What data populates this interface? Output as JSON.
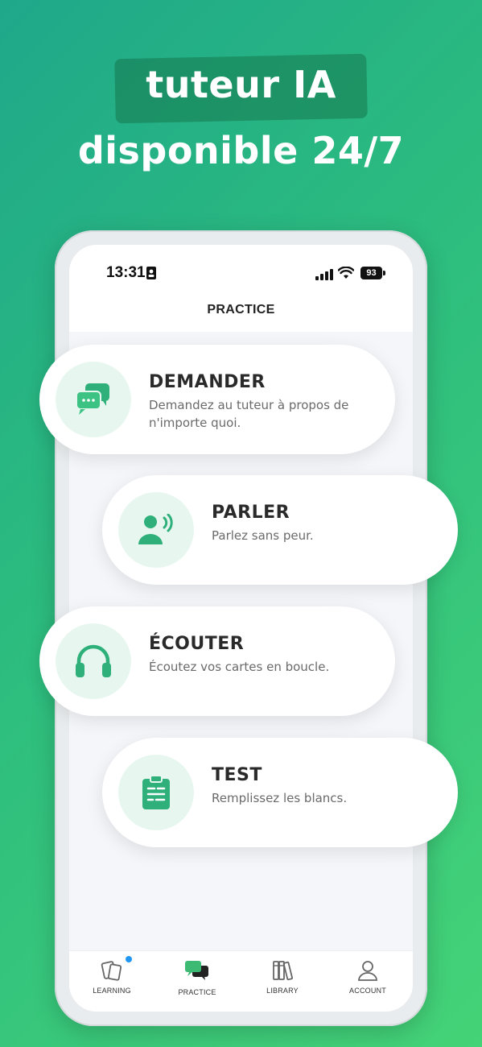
{
  "headline": {
    "line1": "tuteur IA",
    "line2": "disponible 24/7"
  },
  "status_bar": {
    "time": "13:31",
    "battery": "93"
  },
  "screen": {
    "title": "PRACTICE"
  },
  "cards": [
    {
      "title": "DEMANDER",
      "description": "Demandez au tuteur à propos de n'importe quoi.",
      "icon": "chat-bubbles-icon"
    },
    {
      "title": "PARLER",
      "description": "Parlez sans peur.",
      "icon": "speaking-person-icon"
    },
    {
      "title": "ÉCOUTER",
      "description": "Écoutez vos cartes en boucle.",
      "icon": "headphones-icon"
    },
    {
      "title": "TEST",
      "description": "Remplissez les blancs.",
      "icon": "clipboard-icon"
    }
  ],
  "bottom_nav": [
    {
      "label": "LEARNING",
      "icon": "cards-icon",
      "badge": true
    },
    {
      "label": "PRACTICE",
      "icon": "practice-chat-icon",
      "active": true
    },
    {
      "label": "LIBRARY",
      "icon": "books-icon"
    },
    {
      "label": "ACCOUNT",
      "icon": "user-icon"
    }
  ],
  "colors": {
    "accent_green": "#2fb07a",
    "icon_bg": "#e7f7ef",
    "badge_blue": "#2196f3"
  }
}
